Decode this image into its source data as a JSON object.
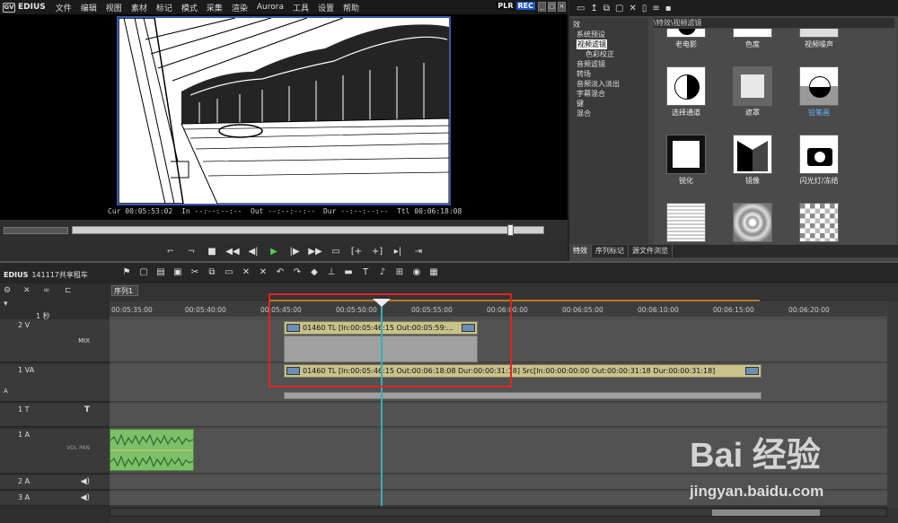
{
  "app": {
    "logo_text": "EDIUS",
    "logo_badge": "GV"
  },
  "menu": [
    "文件",
    "编辑",
    "视图",
    "素材",
    "标记",
    "模式",
    "采集",
    "渲染",
    "Aurora",
    "工具",
    "设置",
    "帮助"
  ],
  "mode": {
    "plr": "PLR",
    "rec": "REC"
  },
  "timecode": {
    "cur_label": "Cur",
    "cur": "00:05:53:02",
    "in_label": "In",
    "in": "--:--:--:--",
    "out_label": "Out",
    "out": "--:--:--:--",
    "dur_label": "Dur",
    "dur": "--:--:--:--",
    "ttl_label": "Ttl",
    "ttl": "00:06:18:08"
  },
  "effects": {
    "path": "\\特效\\视频滤镜",
    "tree": [
      "效",
      "系统预设",
      "视频滤镜",
      "色彩校正",
      "音频滤镜",
      "转场",
      "音频淡入淡出",
      "字幕混合",
      "键",
      "混合"
    ],
    "selected_tree": "视频滤镜",
    "items": [
      {
        "label": "老电影"
      },
      {
        "label": "色度"
      },
      {
        "label": "视频噪声"
      },
      {
        "label": "选择通道"
      },
      {
        "label": "遮罩"
      },
      {
        "label": "铅笔画",
        "highlight": true
      },
      {
        "label": "锐化"
      },
      {
        "label": "镜像"
      },
      {
        "label": "闪光灯/冻结"
      },
      {
        "label": ""
      },
      {
        "label": ""
      },
      {
        "label": ""
      }
    ],
    "tabs": [
      "特效",
      "序列标记",
      "源文件浏览"
    ]
  },
  "timeline": {
    "project_id": "EDIUS",
    "project_name": "141117共享租车",
    "sequence_tab": "序列1",
    "zoom": "1 秒",
    "ruler": [
      "00:05:35:00",
      "00:05:40:00",
      "00:05:45:00",
      "00:05:50:00",
      "00:05:55:00",
      "00:06:00:00",
      "00:06:05:00",
      "00:06:10:00",
      "00:06:15:00",
      "00:06:20:00"
    ],
    "tracks": [
      {
        "name": "2 V",
        "icon": "MIX"
      },
      {
        "name": "1 VA",
        "icon": "A"
      },
      {
        "name": "1 T",
        "icon": "T"
      },
      {
        "name": "1 A",
        "icon": "VOL PAN"
      },
      {
        "name": "2 A",
        "icon": ""
      },
      {
        "name": "3 A",
        "icon": ""
      }
    ],
    "clip_2v": "01460  TL [In:00:05:46:15 Out:00:05:59:...",
    "clip_1va": "01460  TL [In:00:05:46:15 Out:00:06:18:08 Dur:00:00:31:18]  Src[In:00:00:00:00 Out:00:00:31:18 Dur:00:00:31:18]"
  },
  "watermark": {
    "brand": "Bai  经验",
    "url": "jingyan.baidu.com"
  }
}
